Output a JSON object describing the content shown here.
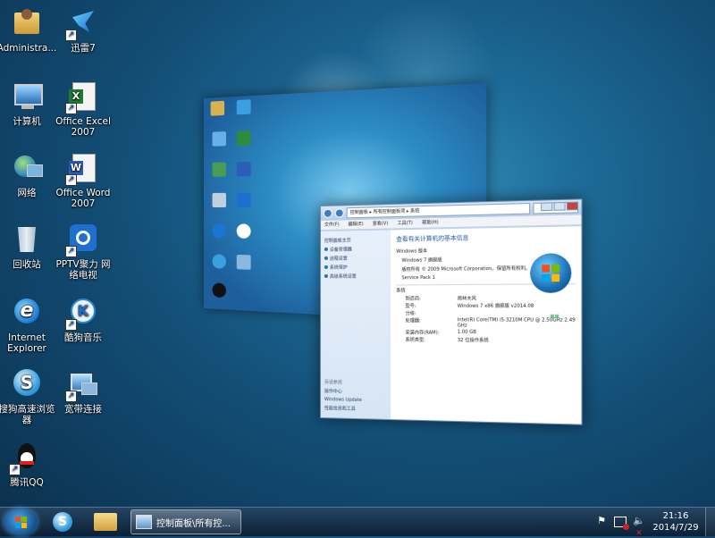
{
  "desktop": {
    "icons": [
      {
        "label": "Administra..."
      },
      {
        "label": "迅雷7"
      },
      {
        "label": "计算机"
      },
      {
        "label": "Office Excel 2007"
      },
      {
        "label": "网络"
      },
      {
        "label": "Office Word 2007"
      },
      {
        "label": "回收站"
      },
      {
        "label": "PPTV聚力 网络电视"
      },
      {
        "label": "Internet Explorer"
      },
      {
        "label": "酷狗音乐"
      },
      {
        "label": "搜狗高速浏览器"
      },
      {
        "label": "宽带连接"
      },
      {
        "label": "腾讯QQ"
      }
    ]
  },
  "flip_window": {
    "address": "控制面板 ▸ 所有控制面板项 ▸ 系统",
    "menu": [
      "文件(F)",
      "编辑(E)",
      "查看(V)",
      "工具(T)",
      "帮助(H)"
    ],
    "left_items": [
      "控制面板主页",
      "设备管理器",
      "远程设置",
      "系统保护",
      "高级系统设置"
    ],
    "see_also": [
      "另请参阅",
      "操作中心",
      "Windows Update",
      "性能信息和工具"
    ],
    "heading": "查看有关计算机的基本信息",
    "edition_title": "Windows 版本",
    "edition": "Windows 7 旗舰版",
    "copyright": "版权所有 © 2009 Microsoft Corporation。保留所有权利。",
    "service_pack": "Service Pack 1",
    "system_title": "系统",
    "kv": [
      {
        "k": "制造商:",
        "v": "雨林木风"
      },
      {
        "k": "型号:",
        "v": "Windows 7 x86 旗舰版 v2014.08"
      },
      {
        "k": "分级:",
        "v": ""
      },
      {
        "k": "处理器:",
        "v": "Intel(R) Core(TM) i5-3210M CPU @ 2.50GHz 2.49 GHz"
      },
      {
        "k": "安装内存(RAM):",
        "v": "1.00 GB"
      },
      {
        "k": "系统类型:",
        "v": "32 位操作系统"
      }
    ]
  },
  "taskbar": {
    "task_label": "控制面板\\所有控...",
    "time": "21:16",
    "date": "2014/7/29"
  },
  "colors": {
    "accent": "#1d6b98"
  }
}
